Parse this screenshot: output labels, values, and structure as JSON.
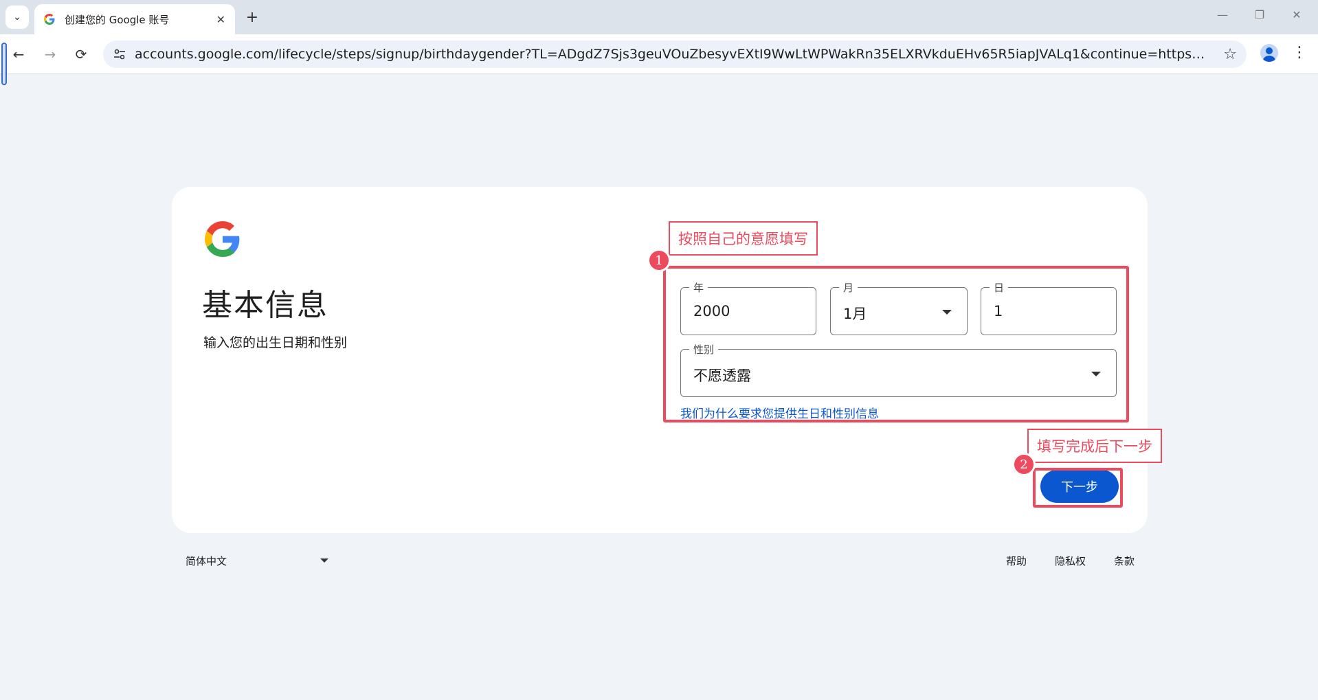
{
  "browser": {
    "tab_title": "创建您的 Google 账号",
    "url": "accounts.google.com/lifecycle/steps/signup/birthdaygender?TL=ADgdZ7Sjs3geuVOuZbesyvEXtI9WwLtWPWakRn35ELXRVkduEHv65R5iapJVALq1&continue=https%3A%2F%2Fmail.goo..."
  },
  "page": {
    "heading": "基本信息",
    "subheading": "输入您的出生日期和性别",
    "year": {
      "label": "年",
      "value": "2000"
    },
    "month": {
      "label": "月",
      "value": "1月"
    },
    "day": {
      "label": "日",
      "value": "1"
    },
    "gender": {
      "label": "性别",
      "value": "不愿透露"
    },
    "why_link": "我们为什么要求您提供生日和性别信息",
    "next_button": "下一步"
  },
  "annotations": {
    "note1": "按照自己的意愿填写",
    "note2": "填写完成后下一步",
    "num1": "1",
    "num2": "2"
  },
  "footer": {
    "language": "简体中文",
    "help": "帮助",
    "privacy": "隐私权",
    "terms": "条款"
  },
  "colors": {
    "accent": "#0b57d0",
    "annotation": "#ee4a5d",
    "background": "#f0f4f9"
  }
}
